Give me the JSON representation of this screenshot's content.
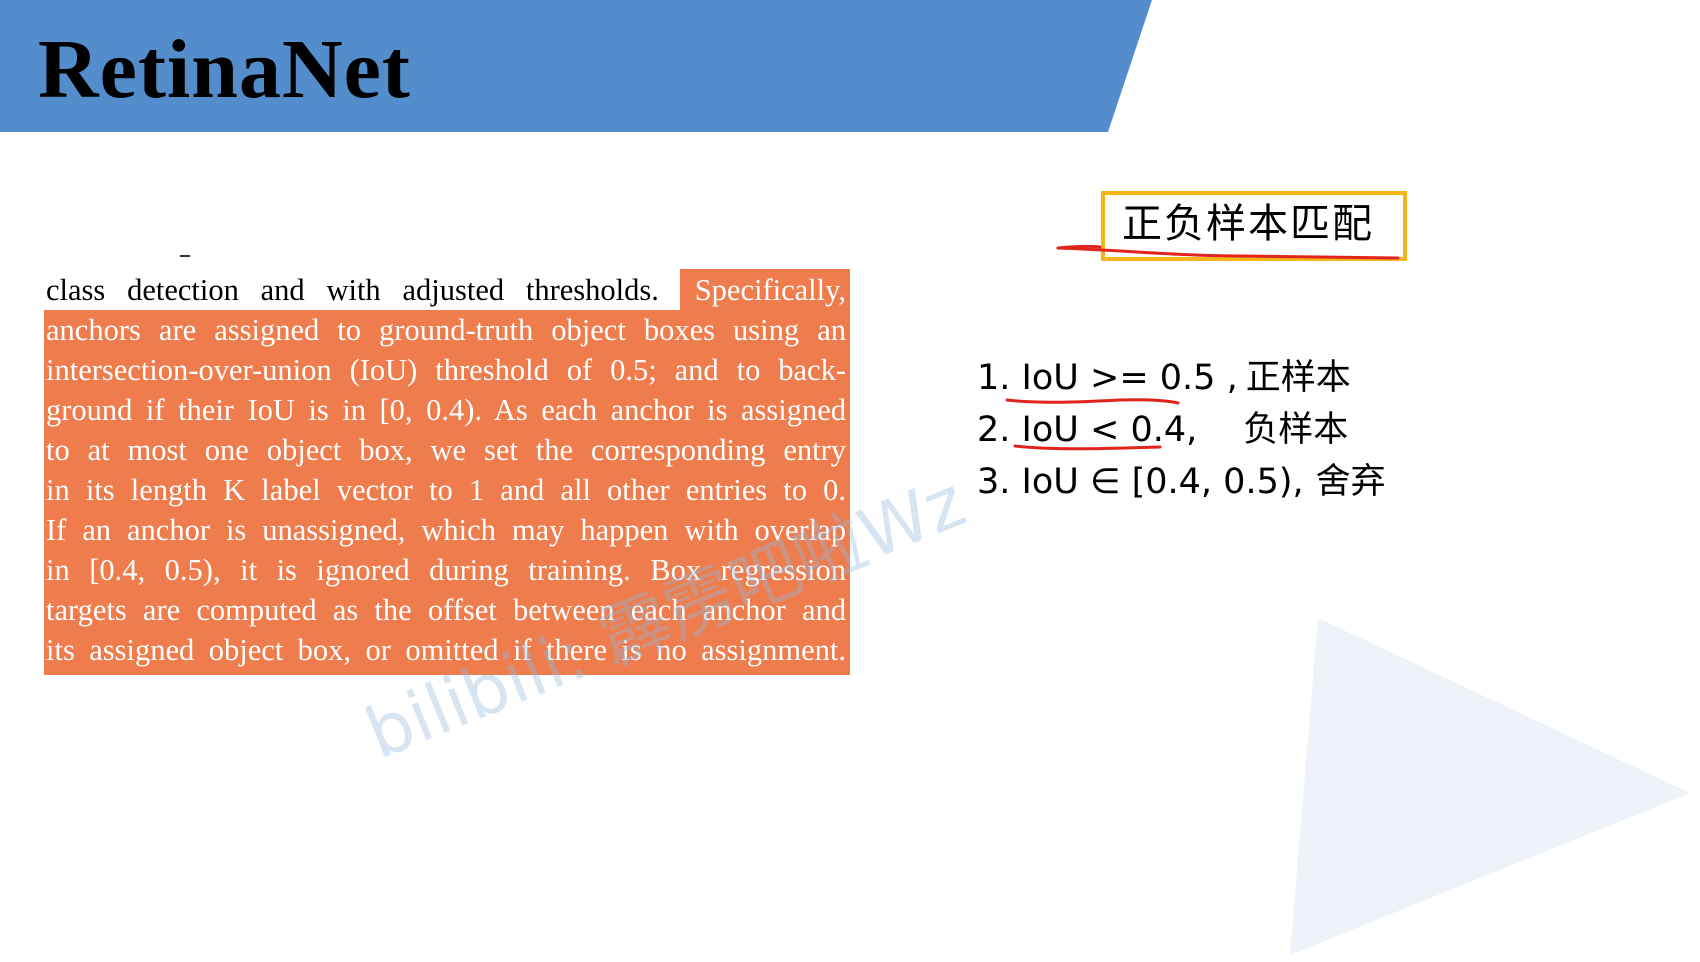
{
  "slide": {
    "title": "RetinaNet",
    "colors": {
      "header_band": "#548dcb",
      "highlight": "#ee7c4c",
      "box_border": "#f5b51b",
      "pen_red": "#e0231c",
      "triangle": "#eef3fa"
    }
  },
  "paper_excerpt": {
    "first_line_plain": "class detection and with adjusted thresholds.",
    "first_line_highlighted": "Specifically,",
    "lines": [
      "anchors are assigned to ground-truth object boxes using an",
      "intersection-over-union (IoU) threshold of 0.5; and to back-",
      "ground if their IoU is in [0, 0.4). As each anchor is assigned",
      "to at most one object box, we set the corresponding entry",
      "in its length K label vector to 1 and all other entries to 0.",
      "If an anchor is unassigned, which may happen with overlap",
      "in [0.4, 0.5), it is ignored during training. Box regression",
      "targets are computed as the offset between each anchor and",
      "its assigned object box, or omitted if there is no assignment."
    ]
  },
  "annotation": {
    "box_label": "正负样本匹配",
    "rules": [
      {
        "condition": "1. IoU >= 0.5 ,",
        "result": "正样本"
      },
      {
        "condition": "2. IoU < 0.4,",
        "result": "负样本"
      },
      {
        "condition": "3. IoU ∈ [0.4, 0.5),",
        "result": "舍弃"
      }
    ]
  },
  "watermark": {
    "text": "bilibili: 霹雳吧啦Wz"
  }
}
